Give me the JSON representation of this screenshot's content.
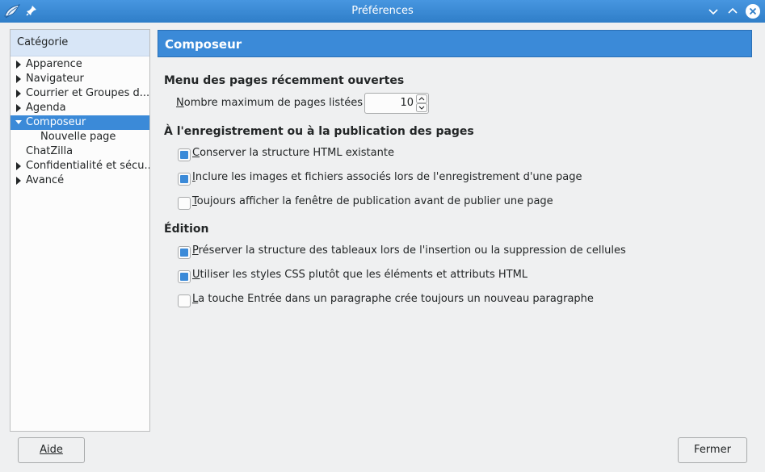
{
  "window": {
    "title": "Préférences",
    "accent_color": "#3b8ad8"
  },
  "sidebar": {
    "header": "Catégorie",
    "items": [
      {
        "label": "Apparence",
        "expandable": true,
        "expanded": false,
        "indent": 0
      },
      {
        "label": "Navigateur",
        "expandable": true,
        "expanded": false,
        "indent": 0
      },
      {
        "label": "Courrier et Groupes d...",
        "expandable": true,
        "expanded": false,
        "indent": 0
      },
      {
        "label": "Agenda",
        "expandable": true,
        "expanded": false,
        "indent": 0
      },
      {
        "label": "Composeur",
        "expandable": true,
        "expanded": true,
        "indent": 0,
        "selected": true
      },
      {
        "label": "Nouvelle page",
        "expandable": false,
        "indent": 1
      },
      {
        "label": "ChatZilla",
        "expandable": false,
        "indent": 0
      },
      {
        "label": "Confidentialité et sécu...",
        "expandable": true,
        "expanded": false,
        "indent": 0
      },
      {
        "label": "Avancé",
        "expandable": true,
        "expanded": false,
        "indent": 0
      }
    ]
  },
  "panel": {
    "title": "Composeur",
    "recent": {
      "title": "Menu des pages récemment ouvertes",
      "max_label_first": "N",
      "max_label_rest": "ombre maximum de pages listées :",
      "max_value": "10"
    },
    "saving": {
      "title": "À l'enregistrement ou à la publication des pages",
      "options": [
        {
          "first": "C",
          "rest": "onserver la structure HTML existante",
          "checked": true
        },
        {
          "first": "I",
          "rest": "nclure les images et fichiers associés lors de l'enregistrement d'une page",
          "checked": true
        },
        {
          "first": "T",
          "rest": "oujours afficher la fenêtre de publication avant de publier une page",
          "checked": false
        }
      ]
    },
    "editing": {
      "title": "Édition",
      "options": [
        {
          "first": "P",
          "rest": "réserver la structure des tableaux lors de l'insertion ou la suppression de cellules",
          "checked": true
        },
        {
          "first": "U",
          "rest": "tiliser les styles CSS plutôt que les éléments et attributs HTML",
          "checked": true
        },
        {
          "first": "L",
          "rest": "a touche Entrée dans un paragraphe crée toujours un nouveau paragraphe",
          "checked": false
        }
      ]
    }
  },
  "buttons": {
    "help": "Aide",
    "close": "Fermer"
  }
}
